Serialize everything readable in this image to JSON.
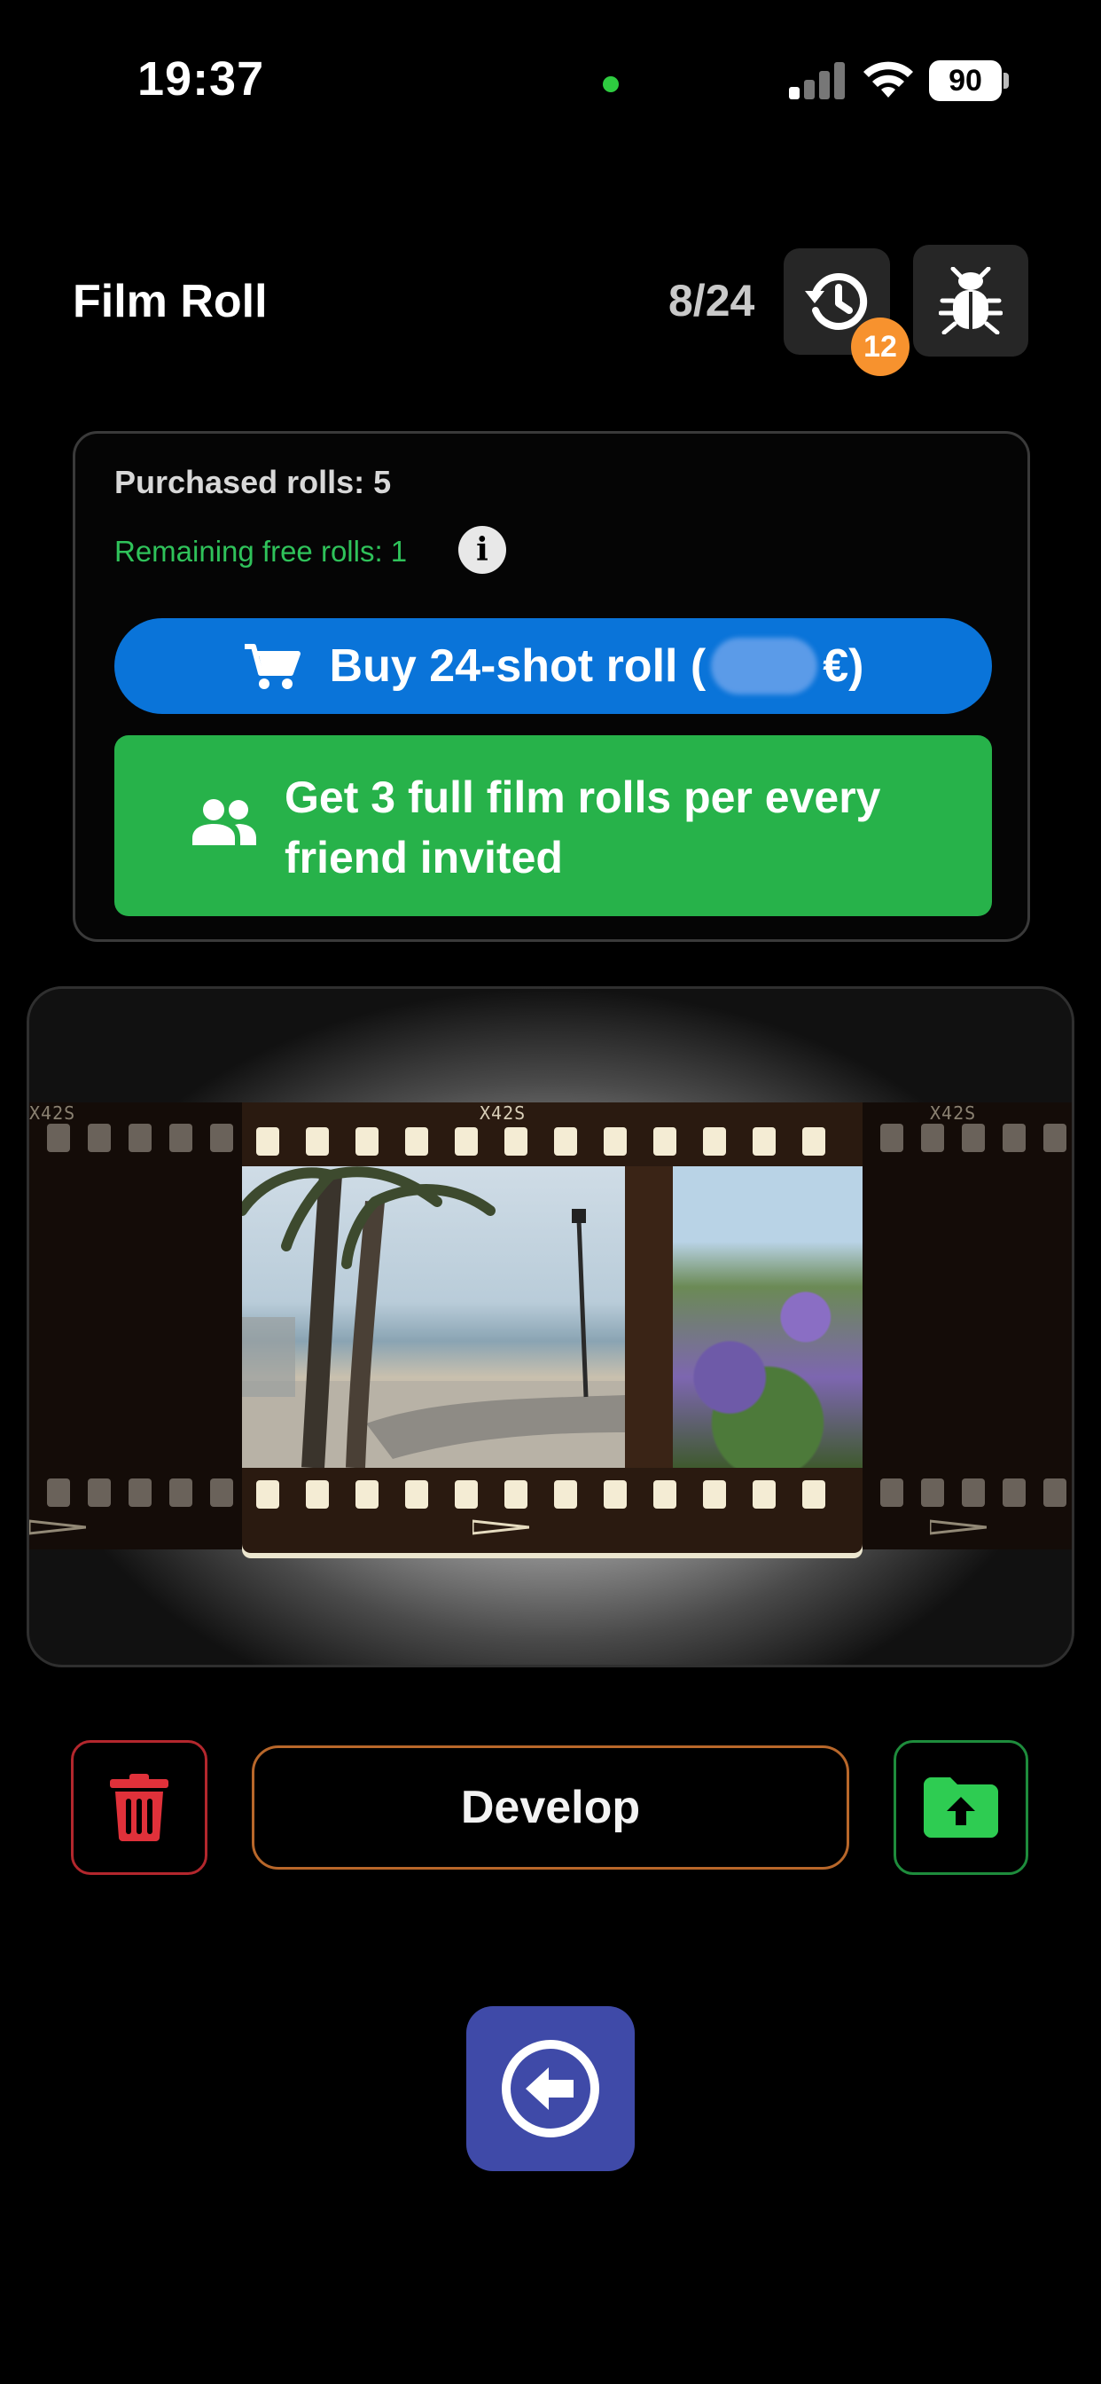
{
  "status_bar": {
    "time": "19:37",
    "battery": "90",
    "privacy_dot_color": "#2ecc40"
  },
  "header": {
    "title": "Film Roll",
    "counter": "8/24",
    "history_badge": "12",
    "history_icon": "history-icon",
    "debug_icon": "bug-icon"
  },
  "rolls_card": {
    "purchased": "Purchased rolls: 5",
    "remaining": "Remaining free rolls: 1",
    "info_icon": "info-icon",
    "buy_label_prefix": "Buy 24-shot roll (",
    "buy_label_suffix": "€)",
    "invite_label": "Get 3 full film rolls per every friend invited"
  },
  "film": {
    "edge_code": "X42S",
    "frames": [
      "beach-promenade-photo",
      "flowers-photo"
    ]
  },
  "actions": {
    "develop_label": "Develop"
  },
  "colors": {
    "buy_blue": "#0a74d9",
    "invite_green": "#27b24a",
    "trash_red": "#b3272d",
    "develop_orange": "#b8672a",
    "upload_green": "#1e8c3c",
    "back_indigo": "#3f4aa8",
    "badge_orange": "#f7922e"
  }
}
